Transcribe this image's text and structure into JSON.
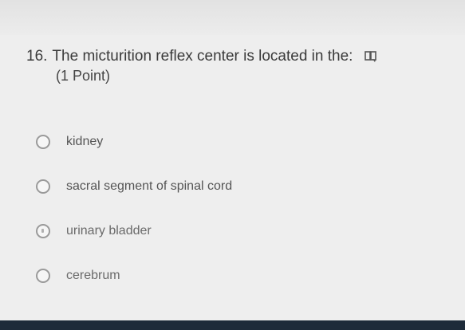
{
  "question": {
    "number": "16.",
    "text": "The micturition reflex center is located in the:",
    "points": "(1 Point)",
    "icon": "immersive-reader-icon"
  },
  "options": [
    {
      "label": "kidney"
    },
    {
      "label": "sacral segment of spinal cord"
    },
    {
      "label": "urinary bladder"
    },
    {
      "label": "cerebrum"
    }
  ]
}
